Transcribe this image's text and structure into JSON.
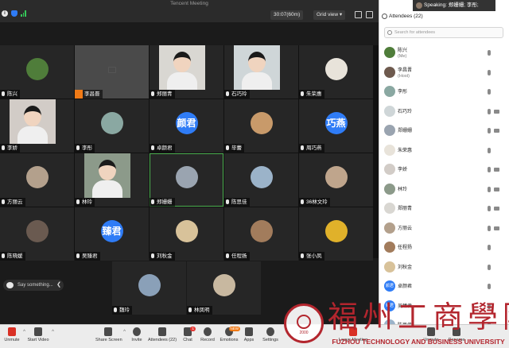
{
  "app": {
    "title": "Tencent Meeting"
  },
  "topbar": {
    "timer": "30:07(60m)",
    "view_label": "Grid view"
  },
  "speaking": "Speaking: 郑姗姗; 李彤;",
  "chat_input": {
    "placeholder": "Say something..."
  },
  "grid": {
    "tiles": [
      {
        "name": "陈兴",
        "kind": "avatar",
        "color": "#4f7d3a"
      },
      {
        "name": "李昌晋",
        "kind": "camoff",
        "mic": "orange"
      },
      {
        "name": "郑丽青",
        "kind": "video",
        "color": "#d9d7d2"
      },
      {
        "name": "石巧玲",
        "kind": "video",
        "color": "#cfd6d8"
      },
      {
        "name": "朱荣惠",
        "kind": "avatar",
        "color": "#e8e3da"
      },
      {
        "name": "李娇",
        "kind": "video",
        "color": "#d2ccc7"
      },
      {
        "name": "李彤",
        "kind": "avatar",
        "color": "#8aa8a2"
      },
      {
        "name": "卓颜君",
        "kind": "text",
        "avatar_text": "颜君"
      },
      {
        "name": "毕蕾",
        "kind": "avatar",
        "color": "#c89a6a"
      },
      {
        "name": "周巧燕",
        "kind": "text",
        "avatar_text": "巧燕"
      },
      {
        "name": "方丽云",
        "kind": "avatar",
        "color": "#b3a08c"
      },
      {
        "name": "林玲",
        "kind": "video",
        "color": "#8c9a8a"
      },
      {
        "name": "郑姗姗",
        "kind": "avatar",
        "color": "#9aa4b0",
        "active": true
      },
      {
        "name": "陈思佳",
        "kind": "avatar",
        "color": "#9bb3c9"
      },
      {
        "name": "36林文玲",
        "kind": "avatar",
        "color": "#bfa58c"
      },
      {
        "name": "陈晓媛",
        "kind": "avatar",
        "color": "#6a5a50"
      },
      {
        "name": "吴臻君",
        "kind": "text",
        "avatar_text": "臻君"
      },
      {
        "name": "刘秋金",
        "kind": "avatar",
        "color": "#d8c29a"
      },
      {
        "name": "任程扬",
        "kind": "avatar",
        "color": "#a27c5c"
      },
      {
        "name": "张小凤",
        "kind": "avatar",
        "color": "#e0b12a"
      },
      {
        "name": "魏玲",
        "kind": "avatar",
        "color": "#8aa0b8"
      },
      {
        "name": "林凤明",
        "kind": "avatar",
        "color": "#c8b8a0"
      }
    ]
  },
  "panel": {
    "title": "Attendees (22)",
    "search_placeholder": "Search for attendees",
    "attendees": [
      {
        "name": "陈兴",
        "sub": "(Me)",
        "color": "#4f7d3a",
        "cam": false
      },
      {
        "name": "李昌晋",
        "sub": "(Host)",
        "color": "#6e5a4e",
        "cam": false
      },
      {
        "name": "李彤",
        "color": "#8aa8a2",
        "cam": false
      },
      {
        "name": "石巧玲",
        "color": "#cfd6d8",
        "cam": true
      },
      {
        "name": "郑姗姗",
        "color": "#9aa4b0",
        "cam": true
      },
      {
        "name": "朱荣惠",
        "color": "#e8e3da",
        "cam": false
      },
      {
        "name": "李娇",
        "color": "#d2ccc7",
        "cam": true
      },
      {
        "name": "林玲",
        "color": "#8c9a8a",
        "cam": true
      },
      {
        "name": "郑丽青",
        "color": "#d9d7d2",
        "cam": true
      },
      {
        "name": "方丽云",
        "color": "#b3a08c",
        "cam": true
      },
      {
        "name": "任程扬",
        "color": "#a27c5c",
        "cam": false
      },
      {
        "name": "刘秋金",
        "color": "#d8c29a",
        "cam": false
      },
      {
        "name": "卓颜君",
        "color": "#2f7cf6",
        "avatar_text": "颜君",
        "cam": false
      },
      {
        "name": "吴臻君",
        "color": "#2f7cf6",
        "avatar_text": "臻君",
        "cam": false
      },
      {
        "name": "陈思佳",
        "color": "#9bb3c9",
        "cam": false
      }
    ]
  },
  "toolbar": {
    "unmute": "Unmute",
    "start_video": "Start Video",
    "share_screen": "Share Screen",
    "invite": "Invite",
    "attendees": "Attendees (22)",
    "chat": "Chat",
    "chat_badge": "1",
    "record": "Record",
    "emotions": "Emotions",
    "emotions_badge": "NEW",
    "apps": "Apps",
    "settings": "Settings",
    "leave": "Leave Meeting",
    "unmute_all": "Unmute",
    "rename": "Rename"
  },
  "watermark": {
    "chars": "福州工商學院",
    "english": "FUZHOU TECHNOLOGY AND BUSINESS UNIVERSITY",
    "year": "2000"
  },
  "colors": {
    "accent": "#2f7cf6",
    "mic_active": "#f07a16",
    "active_border": "#4caf50",
    "brand_red": "#b3262e"
  }
}
